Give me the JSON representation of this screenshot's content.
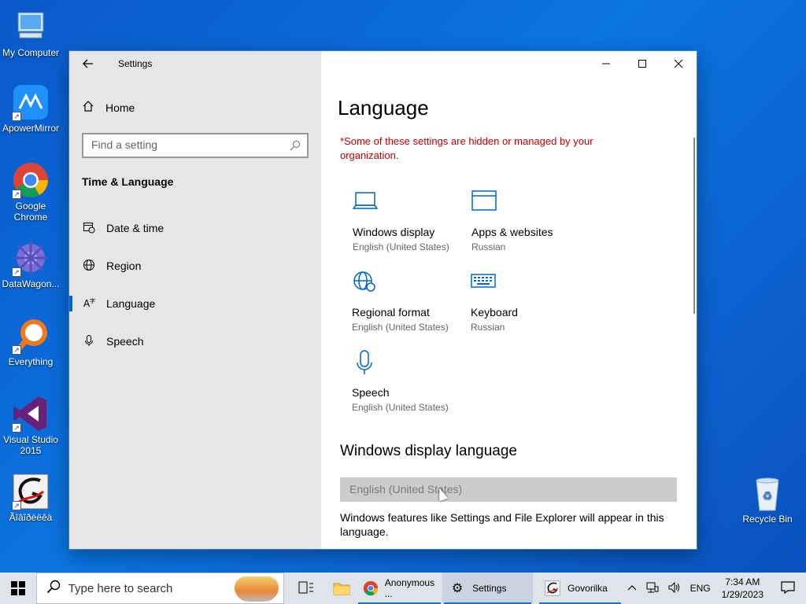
{
  "desktop": {
    "icons": [
      {
        "label": "My Computer"
      },
      {
        "label": "ApowerMirror"
      },
      {
        "label": "Google Chrome"
      },
      {
        "label": "DataWagon..."
      },
      {
        "label": "Everything"
      },
      {
        "label": "Visual Studio 2015"
      },
      {
        "label": "Ãîâîðèëêà"
      },
      {
        "label": "Recycle Bin"
      }
    ]
  },
  "window": {
    "title": "Settings",
    "sidebar": {
      "home_label": "Home",
      "search_placeholder": "Find a setting",
      "section_title": "Time & Language",
      "items": [
        {
          "label": "Date & time",
          "icon": "calendar-clock-icon"
        },
        {
          "label": "Region",
          "icon": "globe-icon"
        },
        {
          "label": "Language",
          "icon": "language-icon",
          "active": true
        },
        {
          "label": "Speech",
          "icon": "microphone-icon"
        }
      ]
    },
    "content": {
      "title": "Language",
      "managed_notice": "*Some of these settings are hidden or managed by your organization.",
      "tiles": [
        {
          "label": "Windows display",
          "sub": "English (United States)",
          "icon": "laptop-icon"
        },
        {
          "label": "Apps & websites",
          "sub": "Russian",
          "icon": "browser-window-icon"
        },
        {
          "label": "Regional format",
          "sub": "English (United States)",
          "icon": "globe-settings-icon"
        },
        {
          "label": "Keyboard",
          "sub": "Russian",
          "icon": "keyboard-icon"
        },
        {
          "label": "Speech",
          "sub": "English (United States)",
          "icon": "microphone-icon"
        }
      ],
      "display_language_heading": "Windows display language",
      "display_language_value": "English (United States)",
      "display_language_desc": "Windows features like Settings and File Explorer will appear in this language."
    }
  },
  "taskbar": {
    "search_placeholder": "Type here to search",
    "apps": [
      {
        "label": "Anonymous ...",
        "icon": "chrome-icon"
      },
      {
        "label": "Settings",
        "icon": "gear-icon"
      },
      {
        "label": "Govorilka",
        "icon": "govorilka-icon"
      }
    ],
    "tray": {
      "language": "ENG",
      "time": "7:34 AM",
      "date": "1/29/2023"
    }
  },
  "colors": {
    "accent": "#0067c0",
    "warning": "#c50000",
    "desktop": "#0a6ad8"
  }
}
